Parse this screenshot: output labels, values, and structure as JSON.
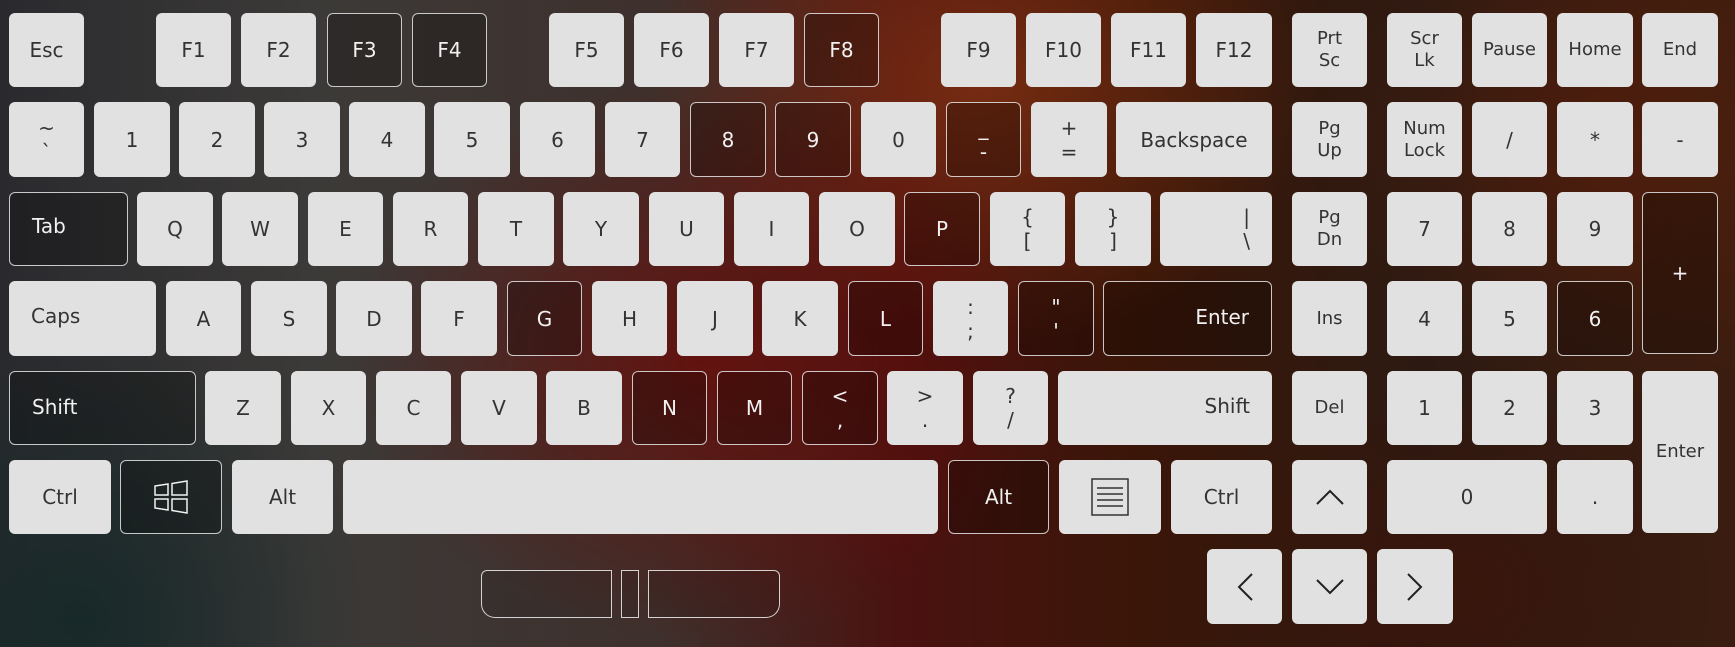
{
  "fn_row": {
    "esc": "Esc",
    "f1": "F1",
    "f2": "F2",
    "f3": "F3",
    "f4": "F4",
    "f5": "F5",
    "f6": "F6",
    "f7": "F7",
    "f8": "F8",
    "f9": "F9",
    "f10": "F10",
    "f11": "F11",
    "f12": "F12",
    "prtsc_top": "Prt",
    "prtsc_bottom": "Sc",
    "scrlk_top": "Scr",
    "scrlk_bottom": "Lk",
    "pause": "Pause",
    "home": "Home",
    "end": "End"
  },
  "number_row": {
    "tilde_top": "~",
    "tilde_bottom": "`",
    "k1": "1",
    "k2": "2",
    "k3": "3",
    "k4": "4",
    "k5": "5",
    "k6": "6",
    "k7": "7",
    "k8": "8",
    "k9": "9",
    "k0": "0",
    "minus_top": "_",
    "minus_bottom": "-",
    "plus_top": "+",
    "plus_bottom": "=",
    "backspace": "Backspace",
    "pgup_top": "Pg",
    "pgup_bottom": "Up",
    "numlock_top": "Num",
    "numlock_bottom": "Lock",
    "np_slash": "/",
    "np_star": "*",
    "np_minus": "-"
  },
  "top_row": {
    "tab": "Tab",
    "q": "Q",
    "w": "W",
    "e": "E",
    "r": "R",
    "t": "T",
    "y": "Y",
    "u": "U",
    "i": "I",
    "o": "O",
    "p": "P",
    "lbrace_top": "{",
    "lbrace_bottom": "[",
    "rbrace_top": "}",
    "rbrace_bottom": "]",
    "pipe_top": "|",
    "pipe_bottom": "\\",
    "pgdn_top": "Pg",
    "pgdn_bottom": "Dn",
    "np7": "7",
    "np8": "8",
    "np9": "9",
    "np_plus": "+"
  },
  "home_row": {
    "caps": "Caps",
    "a": "A",
    "s": "S",
    "d": "D",
    "f": "F",
    "g": "G",
    "h": "H",
    "j": "J",
    "k": "K",
    "l": "L",
    "colon_top": ":",
    "colon_bottom": ";",
    "quote_top": "\"",
    "quote_bottom": "'",
    "enter": "Enter",
    "ins": "Ins",
    "np4": "4",
    "np5": "5",
    "np6": "6"
  },
  "bottom_row": {
    "lshift": "Shift",
    "z": "Z",
    "x": "X",
    "c": "C",
    "v": "V",
    "b": "B",
    "n": "N",
    "m": "M",
    "lt_top": "<",
    "lt_bottom": ",",
    "gt_top": ">",
    "gt_bottom": ".",
    "q_top": "?",
    "q_bottom": "/",
    "rshift": "Shift",
    "del": "Del",
    "np1": "1",
    "np2": "2",
    "np3": "3",
    "np_enter": "Enter"
  },
  "space_row": {
    "lctrl": "Ctrl",
    "lalt": "Alt",
    "ralt": "Alt",
    "rctrl": "Ctrl",
    "np0": "0",
    "np_dot": "."
  },
  "icons": {
    "win": "windows-icon",
    "menu": "menu-icon",
    "up": "chevron-up-icon",
    "left": "chevron-left-icon",
    "down": "chevron-down-icon",
    "right": "chevron-right-icon"
  },
  "colors": {
    "key_light": "#e1e1e1",
    "key_text": "#333333",
    "key_dark_text": "#f1f1f1"
  }
}
